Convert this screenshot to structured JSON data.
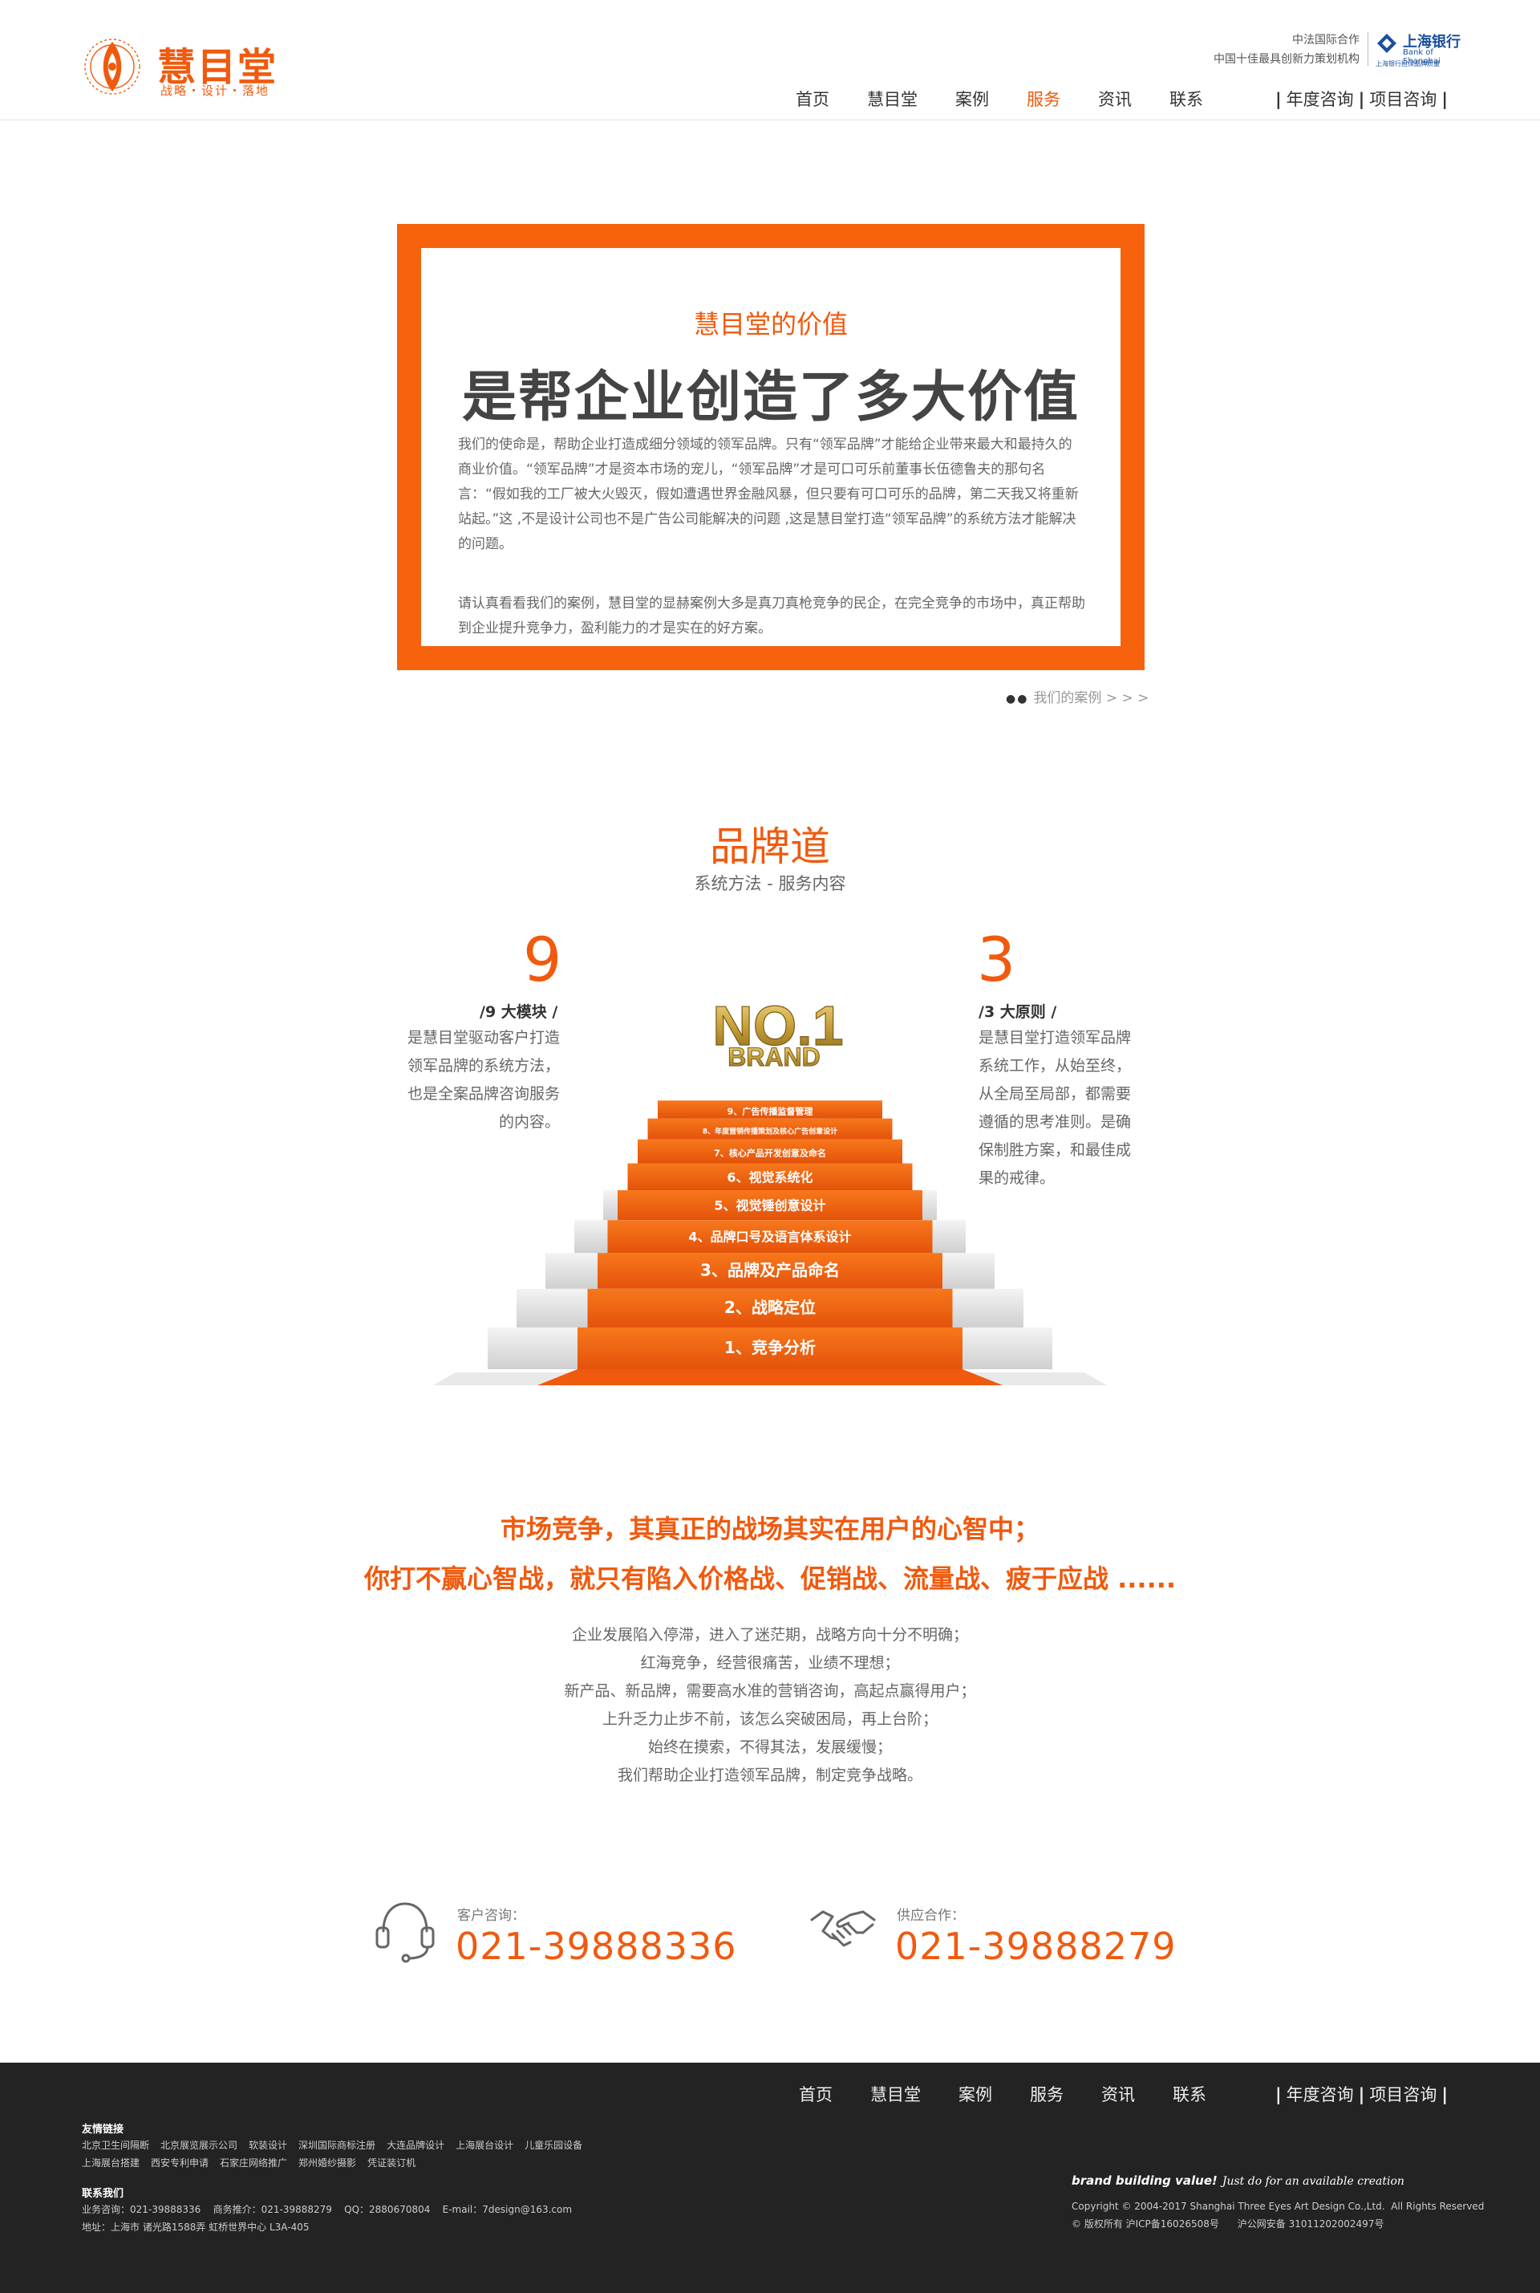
{
  "header": {
    "logo_title": "慧目堂",
    "logo_sub": "战略・设计・落地",
    "partner_line1": "中法国际合作",
    "partner_line2": "中国十佳最具创新力策划机构",
    "bank_name": "上海银行",
    "bank_en": "Bank of Shanghai",
    "bank_sub": "上海银行担保品牌质量"
  },
  "nav": {
    "items": [
      "首页",
      "慧目堂",
      "案例",
      "服务",
      "资讯",
      "联系"
    ],
    "active": "服务",
    "right1": "年度咨询",
    "right2": "项目咨询",
    "sep": "|"
  },
  "value": {
    "kicker": "慧目堂的价值",
    "title": "是帮企业创造了多大价值",
    "p1": "我们的使命是，帮助企业打造成细分领域的领军品牌。只有“领军品牌”才能给企业带来最大和最持久的商业价值。“领军品牌”才是资本市场的宠儿，“领军品牌”才是可口可乐前董事长伍德鲁夫的那句名言：“假如我的工厂被大火毁灭，假如遭遇世界金融风暴，但只要有可口可乐的品牌，第二天我又将重新站起。”这 ,不是设计公司也不是广告公司能解决的问题 ,这是慧目堂打造“领军品牌”的系统方法才能解决的问题。",
    "p2": "请认真看看我们的案例，慧目堂的显赫案例大多是真刀真枪竞争的民企，在完全竞争的市场中，真正帮助到企业提升竞争力，盈利能力的才是实在的好方案。",
    "cases_dots": "●●",
    "cases_link": "我们的案例 > > >"
  },
  "brand": {
    "title": "品牌道",
    "subtitle": "系统方法 - 服务内容",
    "left_num": "9",
    "left_title": "/9 大模块 /",
    "left_lines": [
      "是慧目堂驱动客户打造",
      "领军品牌的系统方法，",
      "也是全案品牌咨询服务",
      "的内容。"
    ],
    "right_num": "3",
    "right_title": "/3 大原则 /",
    "right_lines": [
      "是慧目堂打造领军品牌",
      "系统工作，从始至终，",
      "从全局至局部，都需要",
      "遵循的思考准则。是确",
      "保制胜方案，和最佳成",
      "果的戒律。"
    ],
    "badge_line1": "NO.1",
    "badge_line2": "BRAND",
    "steps": [
      "1、竞争分析",
      "2、战略定位",
      "3、品牌及产品命名",
      "4、品牌口号及语言体系设计",
      "5、视觉锤创意设计",
      "6、视觉系统化",
      "7、核心产品开发创意及命名",
      "8、年度营销传播策划及核心广告创意设计",
      "9、广告传播监督管理"
    ]
  },
  "market": {
    "headline1": "市场竞争，其真正的战场其实在用户的心智中；",
    "headline2": "你打不赢心智战，就只有陷入价格战、促销战、流量战、疲于应战 ......",
    "lines": [
      "企业发展陷入停滞，进入了迷茫期，战略方向十分不明确；",
      "红海竞争，经营很痛苦，业绩不理想；",
      "新产品、新品牌，需要高水准的营销咨询，高起点赢得用户；",
      "上升乏力止步不前，该怎么突破困局，再上台阶；",
      "始终在摸索，不得其法，发展缓慢；",
      "我们帮助企业打造领军品牌，制定竞争战略。"
    ]
  },
  "contact": {
    "customer_label": "客户咨询：",
    "customer_phone": "021-39888336",
    "supplier_label": "供应合作：",
    "supplier_phone": "021-39888279"
  },
  "footer": {
    "links_title": "友情链接",
    "links_row1": [
      "北京卫生间隔断",
      "北京展览展示公司",
      "软装设计",
      "深圳国际商标注册",
      "大连品牌设计",
      "上海展台设计",
      "儿童乐园设备"
    ],
    "links_row2": [
      "上海展台搭建",
      "西安专利申请",
      "石家庄网络推广",
      "郑州婚纱摄影",
      "凭证装订机"
    ],
    "contact_title": "联系我们",
    "contact_line1": "业务咨询：021-39888336    商务推介：021-39888279    QQ：2880670804    E-mail：7design@163.com",
    "contact_line2": "地址：上海市 诸光路1588弄 虹桥世界中心 L3A-405",
    "slogan": "brand building value!",
    "slogan_script": "Just do for an available creation",
    "copyright": "Copyright © 2004-2017 Shanghai Three Eyes Art Design Co.,Ltd.  All Rights Reserved",
    "icp": "© 版权所有 沪ICP备16026508号      沪公网安备 31011202002497号"
  },
  "colors": {
    "accent": "#f05a0e",
    "box_border": "#f7630c",
    "footer_bg": "#232323",
    "bank_blue": "#1b4f9c"
  }
}
